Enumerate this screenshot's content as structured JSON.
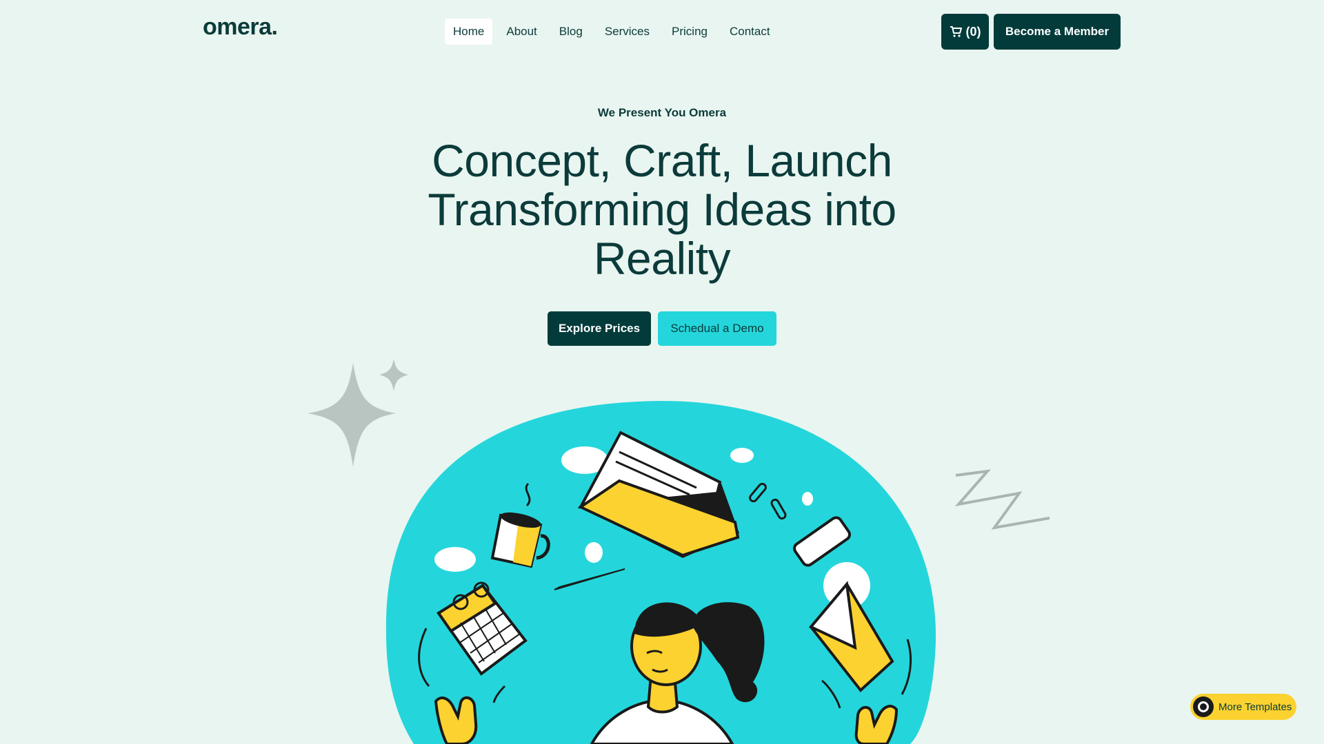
{
  "brand": {
    "logo": "omera."
  },
  "nav": {
    "items": [
      {
        "label": "Home",
        "active": true
      },
      {
        "label": "About"
      },
      {
        "label": "Blog"
      },
      {
        "label": "Services"
      },
      {
        "label": "Pricing"
      },
      {
        "label": "Contact"
      }
    ]
  },
  "header": {
    "cart_icon": "cart-icon",
    "cart_count": "(0)",
    "member_label": "Become a Member"
  },
  "hero": {
    "eyebrow": "We Present You Omera",
    "headline": "Concept, Craft, Launch Transforming Ideas into Reality",
    "primary_cta": "Explore Prices",
    "secondary_cta": "Schedual a Demo"
  },
  "floating": {
    "more_templates": "More Templates"
  },
  "colors": {
    "background": "#e9f5f0",
    "dark": "#033b3b",
    "accent_cyan": "#24d6db",
    "accent_yellow": "#fbd22f"
  }
}
